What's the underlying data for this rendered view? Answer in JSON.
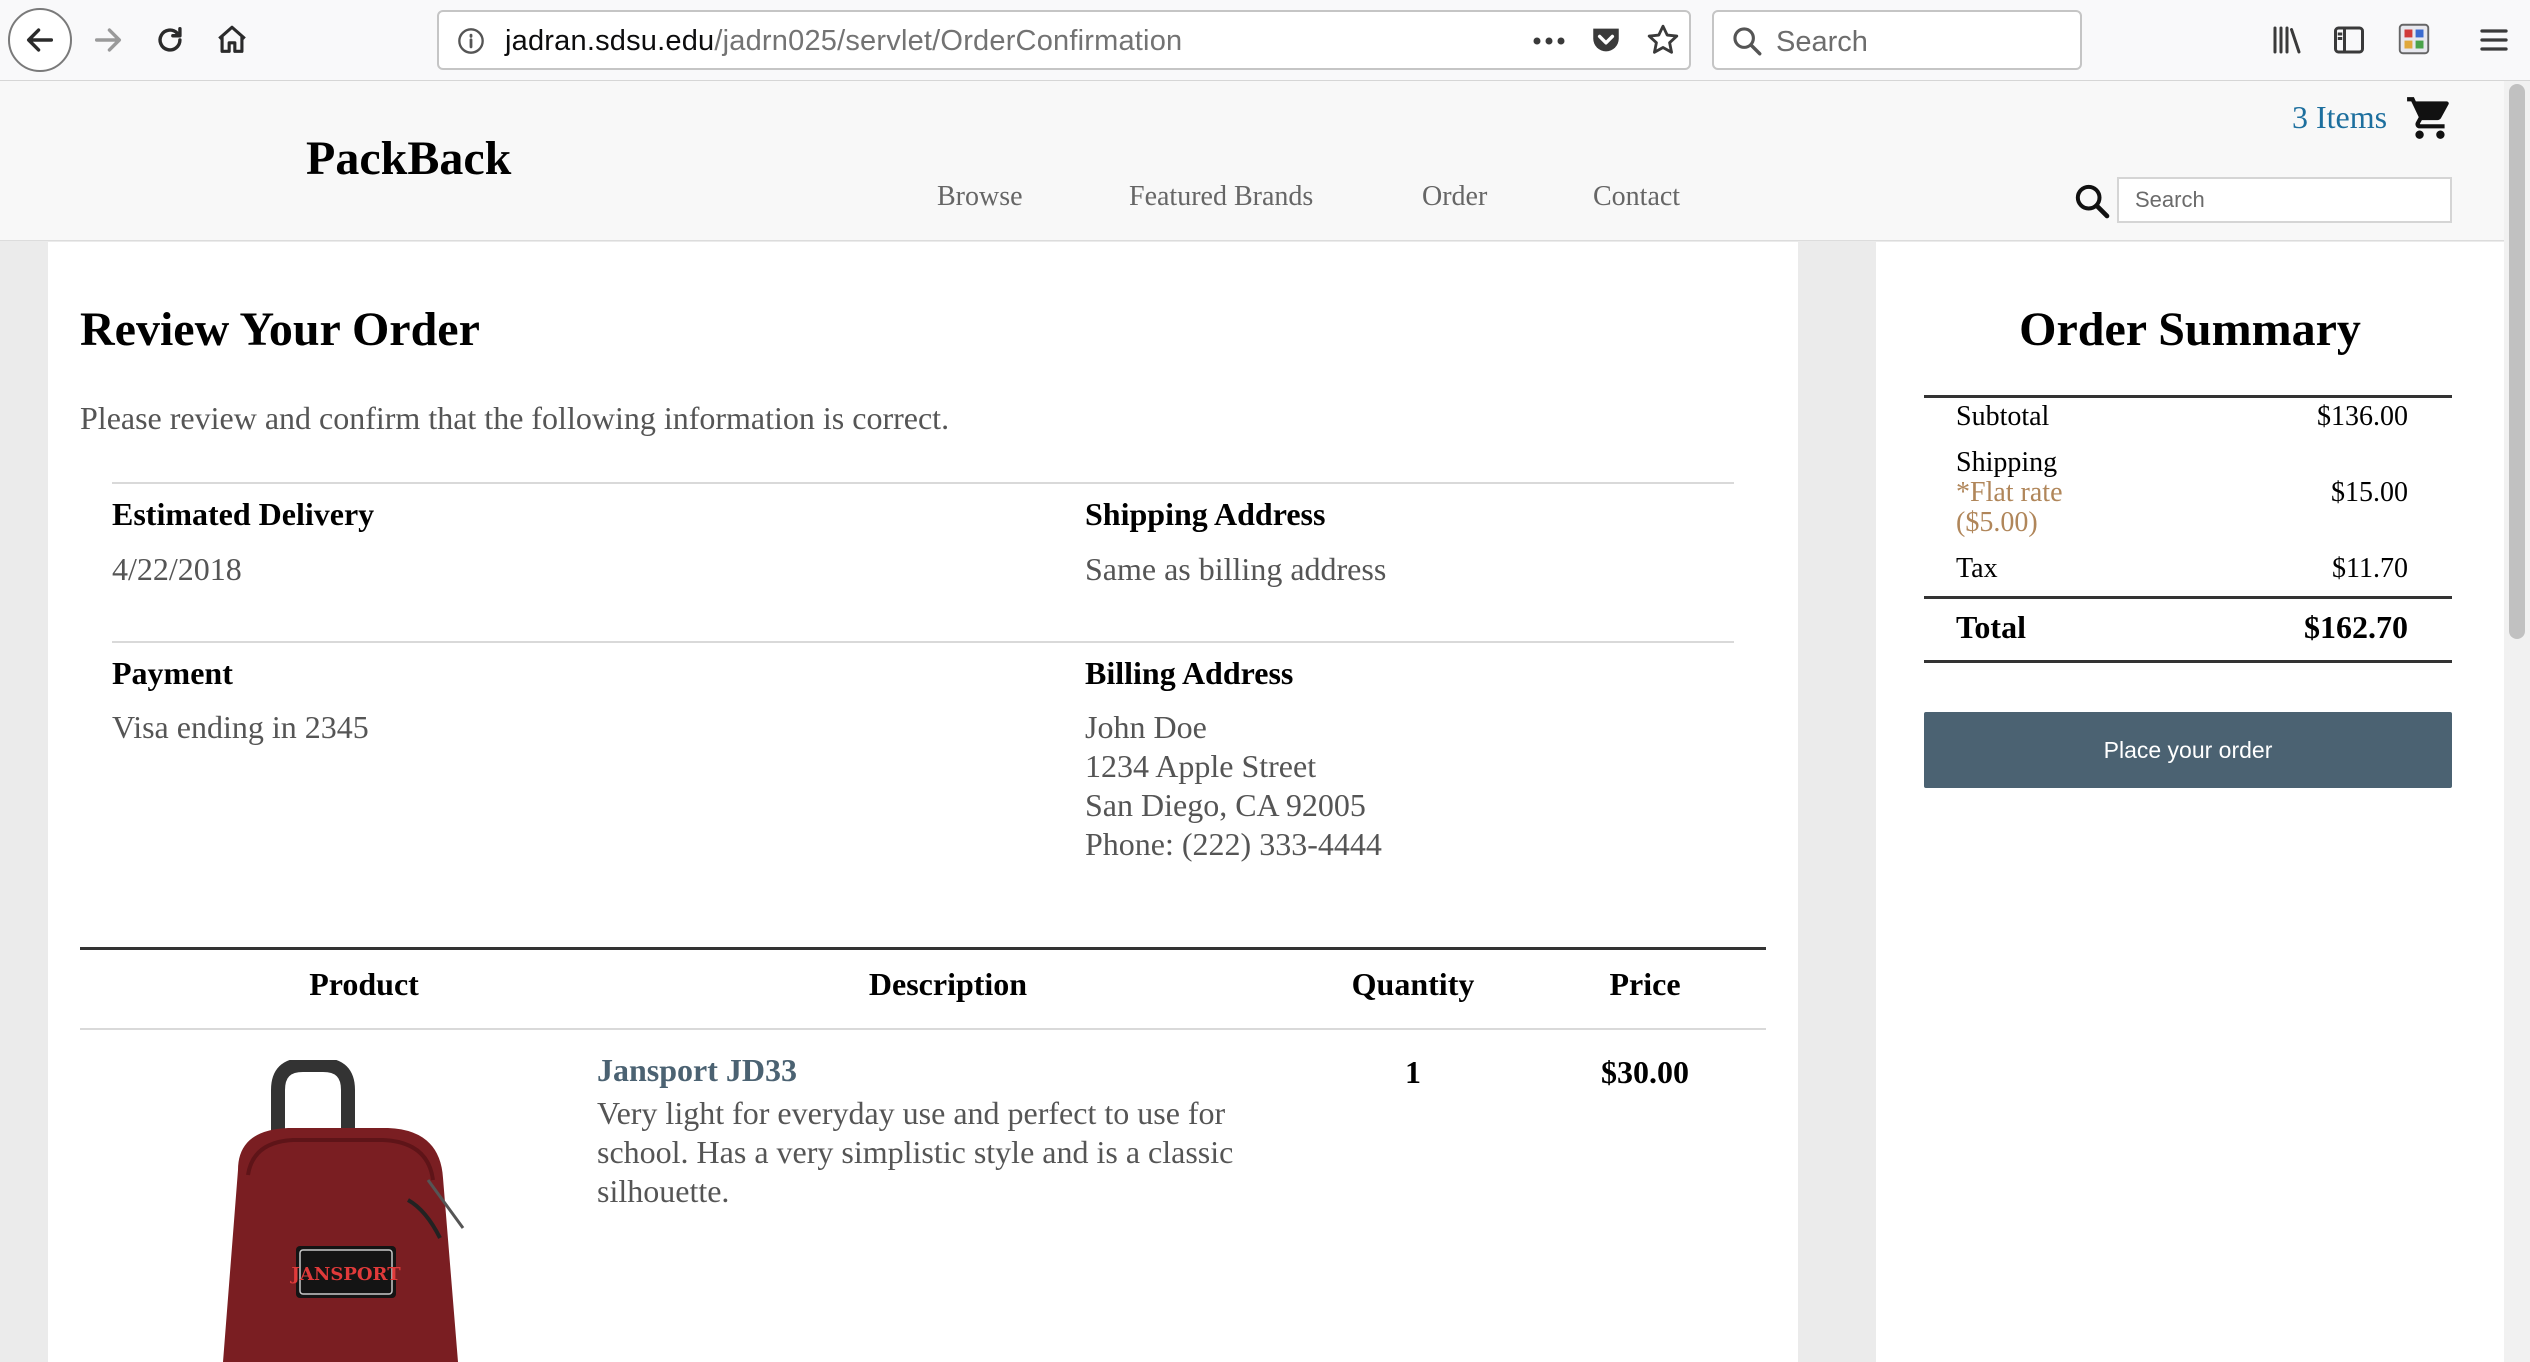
{
  "browser": {
    "url_host": "jadran.sdsu.edu",
    "url_path": "/jadrn025/servlet/OrderConfirmation",
    "search_placeholder": "Search"
  },
  "site": {
    "brand": "PackBack",
    "nav": [
      "Browse",
      "Featured Brands",
      "Order",
      "Contact"
    ],
    "cart_label": "3 Items",
    "search_placeholder": "Search"
  },
  "review": {
    "title": "Review Your Order",
    "intro": "Please review and confirm that the following information is correct.",
    "estimated_delivery_label": "Estimated Delivery",
    "estimated_delivery": "4/22/2018",
    "shipping_address_label": "Shipping Address",
    "shipping_address": "Same as billing address",
    "payment_label": "Payment",
    "payment": "Visa ending in 2345",
    "billing_address_label": "Billing Address",
    "billing_address": [
      "John Doe",
      "1234 Apple Street",
      "San Diego, CA 92005",
      "Phone: (222) 333-4444"
    ]
  },
  "table": {
    "headers": {
      "product": "Product",
      "description": "Description",
      "quantity": "Quantity",
      "price": "Price"
    },
    "items": [
      {
        "name": "Jansport JD33",
        "description": "Very light for everyday use and perfect to use for school. Has a very simplistic style and is a classic silhouette.",
        "quantity": "1",
        "price": "$30.00",
        "brand_patch": "JANSPORT"
      }
    ]
  },
  "summary": {
    "title": "Order Summary",
    "subtotal_label": "Subtotal",
    "subtotal": "$136.00",
    "shipping_label": "Shipping",
    "flat_rate_note": "*Flat rate ($5.00)",
    "shipping": "$15.00",
    "tax_label": "Tax",
    "tax": "$11.70",
    "total_label": "Total",
    "total": "$162.70",
    "place_order_label": "Place your order"
  },
  "colors": {
    "accent": "#4b6272",
    "cart_link": "#1d6f9e",
    "flat_rate_note": "#b0865a"
  }
}
